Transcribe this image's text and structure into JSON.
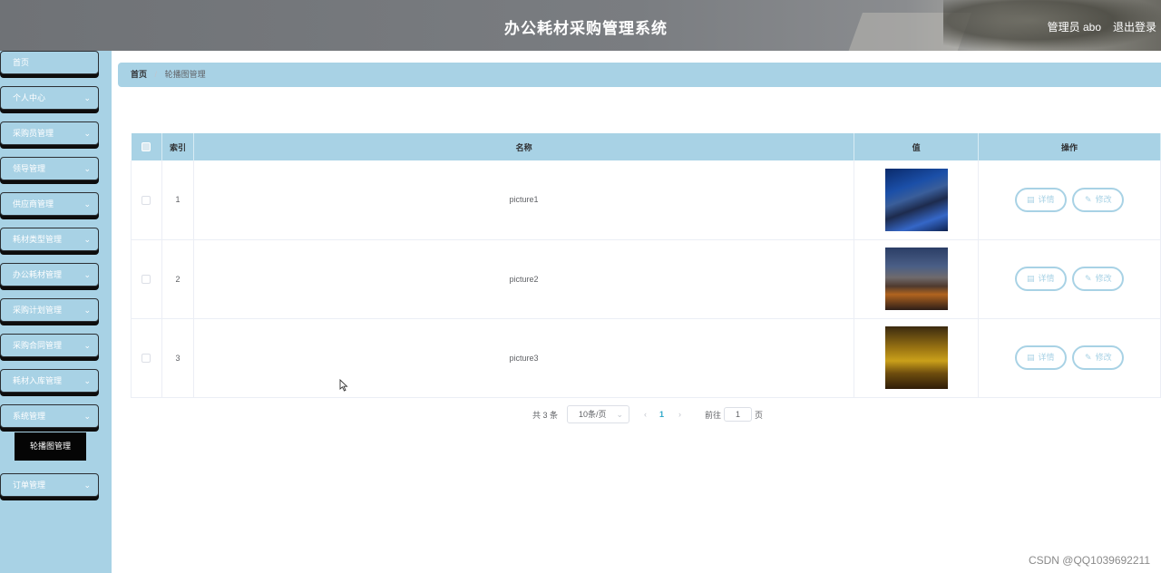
{
  "header": {
    "title": "办公耗材采购管理系统",
    "user_label": "管理员 abo",
    "logout_label": "退出登录"
  },
  "sidebar": {
    "items": [
      {
        "label": "首页",
        "has_arrow": false
      },
      {
        "label": "个人中心",
        "has_arrow": true
      },
      {
        "label": "采购员管理",
        "has_arrow": true
      },
      {
        "label": "领导管理",
        "has_arrow": true
      },
      {
        "label": "供应商管理",
        "has_arrow": true
      },
      {
        "label": "耗材类型管理",
        "has_arrow": true
      },
      {
        "label": "办公耗材管理",
        "has_arrow": true
      },
      {
        "label": "采购计划管理",
        "has_arrow": true
      },
      {
        "label": "采购合同管理",
        "has_arrow": true
      },
      {
        "label": "耗材入库管理",
        "has_arrow": true
      },
      {
        "label": "系统管理",
        "has_arrow": true
      },
      {
        "label": "订单管理",
        "has_arrow": true
      }
    ],
    "active_subitem": "轮播图管理"
  },
  "breadcrumb": {
    "home": "首页",
    "separator": "/",
    "current": "轮播图管理"
  },
  "table": {
    "headers": {
      "index": "索引",
      "name": "名称",
      "value": "值",
      "actions": "操作"
    },
    "rows": [
      {
        "index": "1",
        "name": "picture1",
        "image": "night-building-blue"
      },
      {
        "index": "2",
        "name": "picture2",
        "image": "waterfront-dusk"
      },
      {
        "index": "3",
        "name": "picture3",
        "image": "golden-reflection"
      }
    ],
    "detail_label": "详情",
    "edit_label": "修改",
    "detail_icon": "document-icon",
    "edit_icon": "pencil-icon"
  },
  "pagination": {
    "total": "共 3 条",
    "page_size": "10条/页",
    "prev": "‹",
    "current_page": "1",
    "next": "›",
    "goto_label": "前往",
    "goto_value": "1",
    "page_unit": "页"
  },
  "watermark": "CSDN @QQ1039692211",
  "colors": {
    "accent": "#a8d2e5",
    "active_page": "#2fa8c9",
    "submenu_active_bg": "#050505"
  }
}
